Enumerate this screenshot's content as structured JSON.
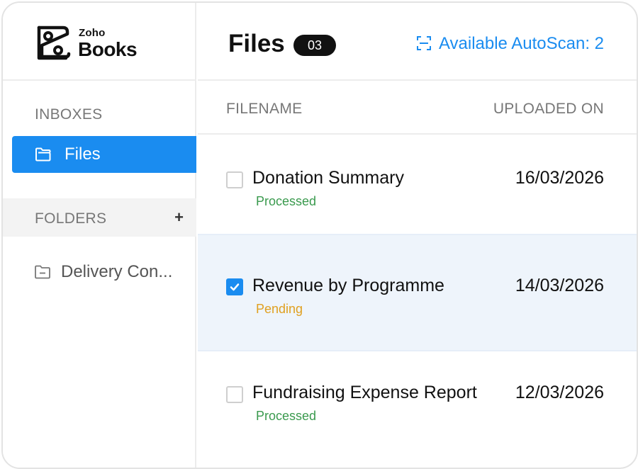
{
  "brand": {
    "small": "Zoho",
    "big": "Books"
  },
  "sidebar": {
    "inboxes_label": "INBOXES",
    "inbox_items": [
      {
        "label": "Files",
        "icon": "folder-open-icon",
        "active": true
      }
    ],
    "folders_label": "FOLDERS",
    "folders_add": "+",
    "folder_items": [
      {
        "label": "Delivery Con...",
        "icon": "folder-icon"
      }
    ]
  },
  "header": {
    "title": "Files",
    "count": "03",
    "autoscan_label": "Available AutoScan: 2",
    "autoscan_icon": "scan-icon"
  },
  "table": {
    "columns": [
      "FILENAME",
      "UPLOADED ON"
    ],
    "rows": [
      {
        "name": "Donation Summary",
        "status": "Processed",
        "date": "16/03/2026",
        "checked": false
      },
      {
        "name": "Revenue by Programme",
        "status": "Pending",
        "date": "14/03/2026",
        "checked": true
      },
      {
        "name": "Fundraising Expense Report",
        "status": "Processed",
        "date": "12/03/2026",
        "checked": false
      }
    ]
  },
  "colors": {
    "accent": "#1a8cf0",
    "processed": "#3a9a4e",
    "pending": "#e0a020",
    "selected_row": "#eef4fb"
  }
}
